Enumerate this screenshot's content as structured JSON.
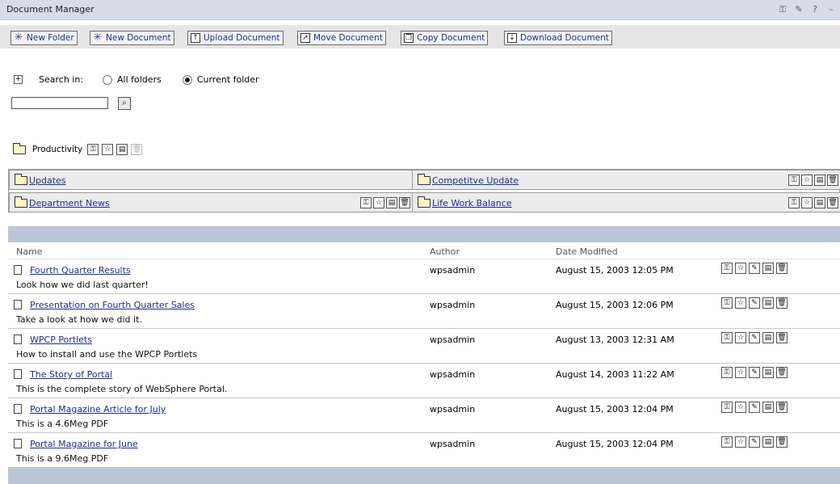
{
  "window": {
    "title": "Document Manager",
    "controls": [
      "key-icon",
      "pencil-icon",
      "help-icon",
      "minimize-icon"
    ]
  },
  "toolbar": {
    "buttons": [
      {
        "label": "New Folder",
        "icon": "new-star-icon"
      },
      {
        "label": "New Document",
        "icon": "new-star-icon"
      },
      {
        "label": "Upload Document",
        "icon": "upload-icon"
      },
      {
        "label": "Move Document",
        "icon": "move-icon"
      },
      {
        "label": "Copy Document",
        "icon": "copy-icon"
      },
      {
        "label": "Download Document",
        "icon": "download-icon"
      }
    ]
  },
  "search": {
    "label": "Search in:",
    "options": [
      "All folders",
      "Current folder"
    ],
    "selected": "Current folder",
    "value": ""
  },
  "current_folder": {
    "name": "Productivity"
  },
  "subfolders": [
    {
      "name": "Updates",
      "icon": "shortcut-folder-icon"
    },
    {
      "name": "Competitve Update",
      "icon": "folder-icon"
    },
    {
      "name": "Department News",
      "icon": "folder-icon"
    },
    {
      "name": "Life Work Balance",
      "icon": "folder-icon"
    }
  ],
  "list": {
    "columns": [
      "Name",
      "Author",
      "Date Modified"
    ],
    "rows": [
      {
        "name": "Fourth Quarter Results",
        "desc": "Look how we did last quarter!",
        "author": "wpsadmin",
        "date": "August 15, 2003 12:05 PM"
      },
      {
        "name": "Presentation on Fourth Quarter Sales",
        "desc": "Take a look at how we did it.",
        "author": "wpsadmin",
        "date": "August 15, 2003 12:06 PM"
      },
      {
        "name": "WPCP Portlets",
        "desc": "How to install and use the WPCP Portlets",
        "author": "wpsadmin",
        "date": "August 13, 2003 12:31 AM"
      },
      {
        "name": "The Story of Portal",
        "desc": "This is the complete story of WebSphere Portal.",
        "author": "wpsadmin",
        "date": "August 14, 2003 11:22 AM"
      },
      {
        "name": "Portal Magazine Article for July",
        "desc": "This is a 4.6Meg PDF",
        "author": "wpsadmin",
        "date": "August 15, 2003 12:04 PM"
      },
      {
        "name": "Portal Magazine for June",
        "desc": "This is a 9.6Meg PDF",
        "author": "wpsadmin",
        "date": "August 15, 2003 12:04 PM"
      }
    ]
  }
}
